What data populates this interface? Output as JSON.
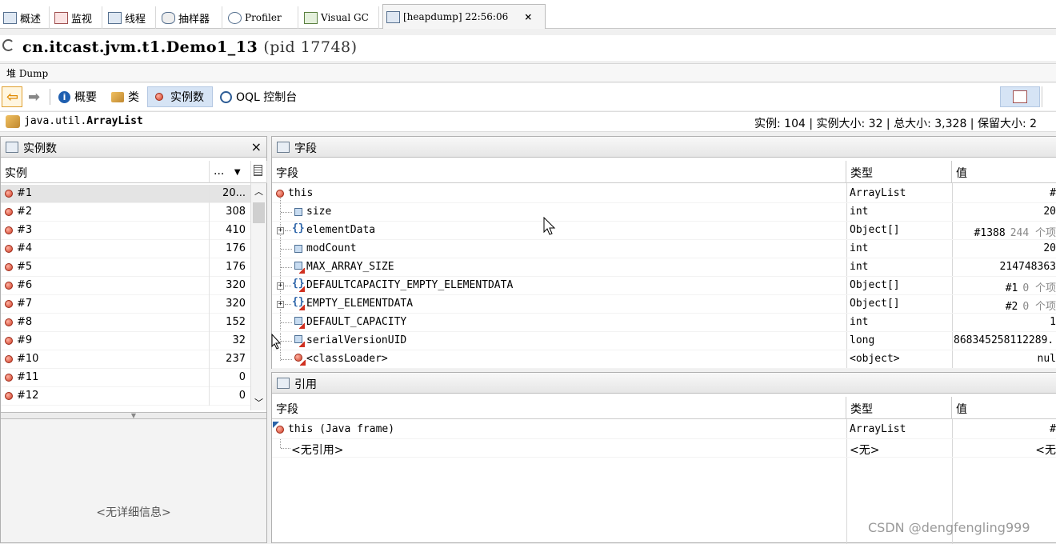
{
  "tabs": [
    {
      "label": "概述",
      "icon": "overview-icon"
    },
    {
      "label": "监视",
      "icon": "monitor-icon"
    },
    {
      "label": "线程",
      "icon": "threads-icon"
    },
    {
      "label": "抽样器",
      "icon": "sampler-icon"
    },
    {
      "label": "Profiler",
      "icon": "profiler-icon"
    },
    {
      "label": "Visual GC",
      "icon": "visualgc-icon"
    },
    {
      "label": "[heapdump] 22:56:06",
      "icon": "heapdump-icon"
    }
  ],
  "title": {
    "app": "cn.itcast.jvm.t1.Demo1_13",
    "pid": "(pid 17748)"
  },
  "heap_label": "堆 Dump",
  "toolbar": {
    "summary": "概要",
    "classes": "类",
    "instances": "实例数",
    "oql": "OQL 控制台"
  },
  "class_info": {
    "name_prefix": "java.util.",
    "name_bold": "ArrayList",
    "stats": "实例: 104 | 实例大小: 32 | 总大小: 3,328 | 保留大小: 2"
  },
  "instances_panel": {
    "title": "实例数",
    "col_instance": "实例",
    "col_size": "...",
    "rows": [
      {
        "name": "#1",
        "size": "20..."
      },
      {
        "name": "#2",
        "size": "308"
      },
      {
        "name": "#3",
        "size": "410"
      },
      {
        "name": "#4",
        "size": "176"
      },
      {
        "name": "#5",
        "size": "176"
      },
      {
        "name": "#6",
        "size": "320"
      },
      {
        "name": "#7",
        "size": "320"
      },
      {
        "name": "#8",
        "size": "152"
      },
      {
        "name": "#9",
        "size": "32"
      },
      {
        "name": "#10",
        "size": "237"
      },
      {
        "name": "#11",
        "size": "0"
      },
      {
        "name": "#12",
        "size": "0"
      }
    ],
    "detail_empty": "<无详细信息>"
  },
  "fields_panel": {
    "title": "字段",
    "col_field": "字段",
    "col_type": "类型",
    "col_value": "值",
    "rows": [
      {
        "name": "this",
        "type": "ArrayList",
        "value": "#",
        "extra": ""
      },
      {
        "name": "size",
        "type": "int",
        "value": "20",
        "extra": ""
      },
      {
        "name": "elementData",
        "type": "Object[]",
        "value": "#1388",
        "extra": "244 个项"
      },
      {
        "name": "modCount",
        "type": "int",
        "value": "20",
        "extra": ""
      },
      {
        "name": "MAX_ARRAY_SIZE",
        "type": "int",
        "value": "214748363",
        "extra": ""
      },
      {
        "name": "DEFAULTCAPACITY_EMPTY_ELEMENTDATA",
        "type": "Object[]",
        "value": "#1",
        "extra": "0 个项"
      },
      {
        "name": "EMPTY_ELEMENTDATA",
        "type": "Object[]",
        "value": "#2",
        "extra": "0 个项"
      },
      {
        "name": "DEFAULT_CAPACITY",
        "type": "int",
        "value": "1",
        "extra": ""
      },
      {
        "name": "serialVersionUID",
        "type": "long",
        "value": "868345258112289...",
        "extra": ""
      },
      {
        "name": "<classLoader>",
        "type": "<object>",
        "value": "nul",
        "extra": ""
      }
    ]
  },
  "refs_panel": {
    "title": "引用",
    "col_field": "字段",
    "col_type": "类型",
    "col_value": "值",
    "rows": [
      {
        "name": "this (Java frame)",
        "type": "ArrayList",
        "value": "#"
      },
      {
        "name": "<无引用>",
        "type": "<无>",
        "value": "<无"
      }
    ]
  },
  "watermark": "CSDN @dengfengling999"
}
